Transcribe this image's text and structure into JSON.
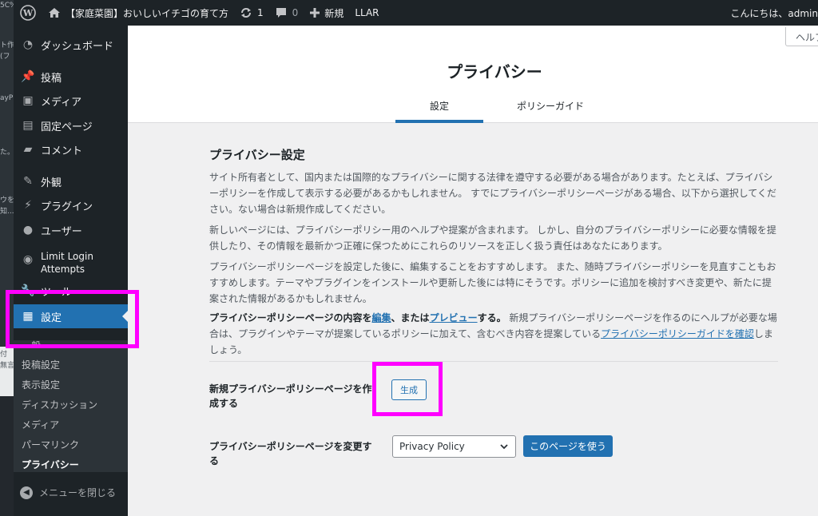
{
  "bleed": {
    "lines": [
      "5C%",
      "ト作",
      "(フ",
      "ayP",
      "た。",
      "ウを",
      "知...",
      "付",
      "無言"
    ]
  },
  "adminbar": {
    "site_title": "【家庭菜園】おいしいイチゴの育て方",
    "updates_count": "1",
    "comments_count": "0",
    "new_label": "新規",
    "llar_label": "LLAR",
    "greeting": "こんにちは、admin"
  },
  "sidebar": {
    "items": [
      {
        "label": "ダッシュボード",
        "icon": "dashboard-icon"
      },
      {
        "label": "投稿",
        "icon": "pin-icon"
      },
      {
        "label": "メディア",
        "icon": "media-icon"
      },
      {
        "label": "固定ページ",
        "icon": "page-icon"
      },
      {
        "label": "コメント",
        "icon": "comment-icon"
      },
      {
        "label": "外観",
        "icon": "brush-icon"
      },
      {
        "label": "プラグイン",
        "icon": "plugin-icon"
      },
      {
        "label": "ユーザー",
        "icon": "user-icon"
      },
      {
        "label": "Limit Login",
        "label2": "Attempts",
        "icon": "limit-login-icon"
      },
      {
        "label": "ツール",
        "icon": "tools-icon"
      },
      {
        "label": "設定",
        "icon": "settings-icon"
      }
    ],
    "submenu": [
      "一般",
      "投稿設定",
      "表示設定",
      "ディスカッション",
      "メディア",
      "パーマリンク",
      "プライバシー"
    ],
    "collapse_label": "メニューを閉じる"
  },
  "header": {
    "title": "プライバシー",
    "tabs": [
      "設定",
      "ポリシーガイド"
    ],
    "help_label": "ヘルプ"
  },
  "main": {
    "section_title": "プライバシー設定",
    "para1": "サイト所有者として、国内または国際的なプライバシーに関する法律を遵守する必要がある場合があります。たとえば、プライバシーポリシーを作成して表示する必要があるかもしれません。 すでにプライバシーポリシーページがある場合、以下から選択してください。ない場合は新規作成してください。",
    "para2": "新しいページには、プライバシーポリシー用のヘルプや提案が含まれます。 しかし、自分のプライバシーポリシーに必要な情報を提供したり、その情報を最新かつ正確に保つためにこれらのリソースを正しく扱う責任はあなたにあります。",
    "para3": "プライバシーポリシーページを設定した後に、編集することをおすすめします。 また、随時プライバシーポリシーを見直すこともおすすめします。テーマやプラグインをインストールや更新した後には特にそうです。ポリシーに追加を検討すべき変更や、新たに提案された情報があるかもしれません。",
    "para4": {
      "lead": "プライバシーポリシーページの内容を",
      "edit_link": "編集",
      "mid": "、または",
      "preview_link": "プレビュー",
      "tail": "する。",
      "rest": " 新規プライバシーポリシーページを作るのにヘルプが必要な場合は、プラグインやテーマが提案しているポリシーに加えて、含むべき内容を提案している",
      "guide_link": "プライバシーポリシーガイドを確認",
      "end": "しましょう。"
    },
    "create_label": "新規プライバシーポリシーページを作成する",
    "create_button": "生成",
    "change_label": "プライバシーポリシーページを変更する",
    "select_value": "Privacy Policy",
    "use_button": "このページを使う"
  },
  "colors": {
    "admin_bar": "#1d2327",
    "accent_blue": "#2271b1",
    "highlight": "#ff00ff"
  }
}
